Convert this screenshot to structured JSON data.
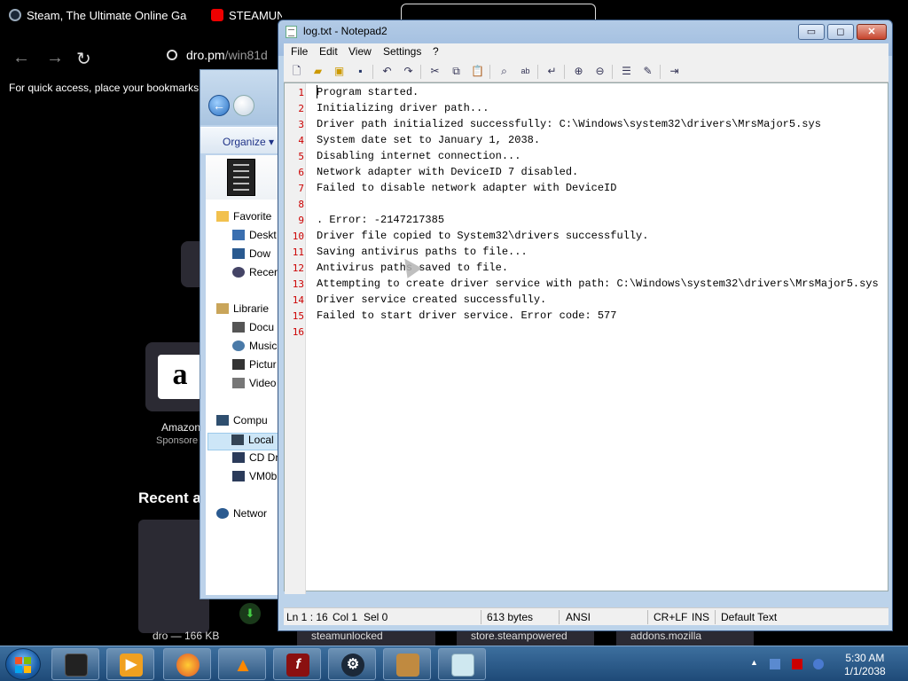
{
  "browser": {
    "tabs": [
      {
        "label": "Steam, The Ultimate Online Ga",
        "close": "✕"
      },
      {
        "label": "STEAMUN"
      }
    ],
    "url_host": "dro.pm",
    "url_path": "/win81d",
    "bookmarks_hint": "For quick access, place your bookmarks i",
    "shortcut_label": "Amazon",
    "shortcut_sponsored": "Sponsore",
    "recent_heading": "Recent a",
    "download_text": "dro — 166 KB",
    "download_chips": [
      "steamunlocked",
      "store.steampowered",
      "addons.mozilla"
    ]
  },
  "explorer": {
    "organize_label": "Organize ▾",
    "nav": [
      {
        "label": "Favorite"
      },
      {
        "label": "Deskt"
      },
      {
        "label": "Dow"
      },
      {
        "label": "Recer"
      },
      {
        "label": "Librarie"
      },
      {
        "label": "Docu"
      },
      {
        "label": "Music"
      },
      {
        "label": "Pictur"
      },
      {
        "label": "Video"
      },
      {
        "label": "Compu"
      },
      {
        "label": "Local"
      },
      {
        "label": "CD Dr"
      },
      {
        "label": "VM0b"
      },
      {
        "label": "Networ"
      }
    ]
  },
  "notepad": {
    "title": "log.txt - Notepad2",
    "window_buttons": {
      "minimize": "▭",
      "maximize": "◻",
      "close": "✕"
    },
    "menu": [
      "File",
      "Edit",
      "View",
      "Settings",
      "?"
    ],
    "line_numbers": [
      "1",
      "2",
      "3",
      "4",
      "5",
      "6",
      "7",
      "8",
      "9",
      "10",
      "11",
      "12",
      "13",
      "14",
      "15",
      "16"
    ],
    "lines": [
      "Program started.",
      "Initializing driver path...",
      "Driver path initialized successfully: C:\\Windows\\system32\\drivers\\MrsMajor5.sys",
      "System date set to January 1, 2038.",
      "Disabling internet connection...",
      "Network adapter with DeviceID 7 disabled.",
      "Failed to disable network adapter with DeviceID",
      "",
      ". Error: -2147217385",
      "Driver file copied to System32\\drivers successfully.",
      "Saving antivirus paths to file...",
      "Antivirus paths saved to file.",
      "Attempting to create driver service with path: C:\\Windows\\system32\\drivers\\MrsMajor5.sys",
      "Driver service created successfully.",
      "Failed to start driver service. Error code: 577",
      ""
    ],
    "status": {
      "position": "Ln 1 : 16",
      "column": "Col 1",
      "selection": "Sel 0",
      "size": "613 bytes",
      "encoding": "ANSI",
      "line_endings": "CR+LF",
      "mode": "INS",
      "scheme": "Default Text"
    }
  },
  "taskbar": {
    "time": "5:30 AM",
    "date": "1/1/2038",
    "apps": [
      "explorer-icon",
      "media-player-icon",
      "firefox-icon",
      "vlc-icon",
      "flash-icon",
      "steam-icon",
      "app-icon",
      "notepad-icon"
    ]
  },
  "colors": {
    "line_number": "#cc0000",
    "taskbar": "#1e4a78",
    "browser_bg": "#000000"
  }
}
